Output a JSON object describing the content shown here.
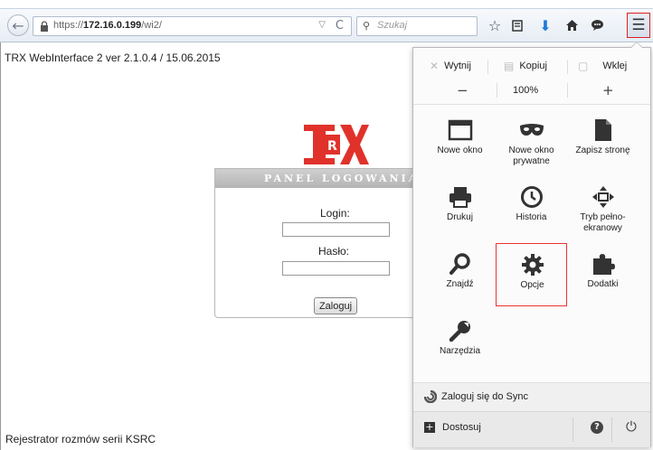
{
  "browser": {
    "url_prefix": "https://",
    "url_host": "172.16.0.199",
    "url_path": "/wi2/",
    "search_placeholder": "Szukaj"
  },
  "page": {
    "version_text": "TRX WebInterface 2 ver 2.1.0.4 / 15.06.2015",
    "footer_text": "Rejestrator rozmów serii KSRC",
    "logo_text": "TRX",
    "brand_color": "#e0322b",
    "panel": {
      "title": "PANEL LOGOWANIA",
      "login_label": "Login:",
      "password_label": "Hasło:",
      "submit_label": "Zaloguj"
    }
  },
  "menu": {
    "edit": {
      "cut": "Wytnij",
      "copy": "Kopiuj",
      "paste": "Wklej"
    },
    "zoom": {
      "minus": "−",
      "value": "100%",
      "plus": "+"
    },
    "items": [
      {
        "label": "Nowe okno",
        "icon": "window-icon"
      },
      {
        "label": "Nowe okno prywatne",
        "icon": "mask-icon"
      },
      {
        "label": "Zapisz stronę",
        "icon": "page-icon"
      },
      {
        "label": "Drukuj",
        "icon": "printer-icon"
      },
      {
        "label": "Historia",
        "icon": "clock-icon"
      },
      {
        "label": "Tryb pełno-ekranowy",
        "icon": "fullscreen-icon"
      },
      {
        "label": "Znajdź",
        "icon": "magnifier-icon"
      },
      {
        "label": "Opcje",
        "icon": "gear-icon"
      },
      {
        "label": "Dodatki",
        "icon": "puzzle-icon"
      },
      {
        "label": "Narzędzia",
        "icon": "wrench-icon"
      }
    ],
    "sync_label": "Zaloguj się do Sync",
    "customize_label": "Dostosuj"
  }
}
